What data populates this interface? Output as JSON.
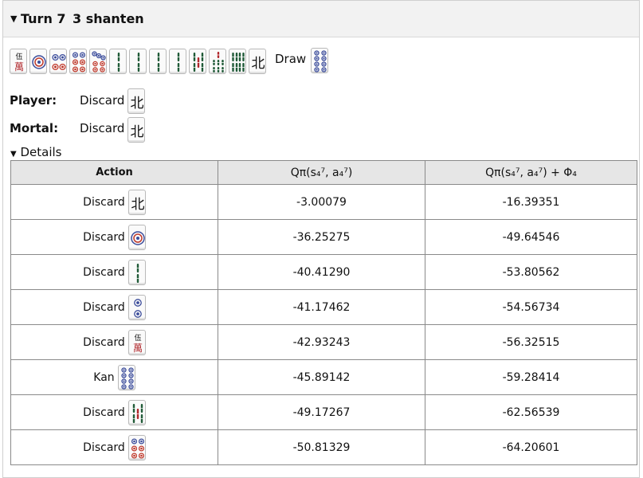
{
  "header": {
    "turn_label": "Turn 7",
    "shanten_label": "3 shanten"
  },
  "hand": {
    "tiles": [
      "7m",
      "1p",
      "4p",
      "6p",
      "7p",
      "1s",
      "1s",
      "1s",
      "2s",
      "5s",
      "7s",
      "8s",
      "N"
    ],
    "draw_label": "Draw",
    "draw_tile": "8p"
  },
  "player": {
    "label": "Player:",
    "action": "Discard",
    "tile": "N"
  },
  "mortal": {
    "label": "Mortal:",
    "action": "Discard",
    "tile": "N"
  },
  "details": {
    "label": "Details"
  },
  "table": {
    "headers": [
      "Action",
      "Qπ(s₄⁷, a₄⁷)",
      "Qπ(s₄⁷, a₄⁷) + Φ₄"
    ],
    "rows": [
      {
        "action": "Discard",
        "tile": "N",
        "q": "-3.00079",
        "qphi": "-16.39351"
      },
      {
        "action": "Discard",
        "tile": "1p",
        "q": "-36.25275",
        "qphi": "-49.64546"
      },
      {
        "action": "Discard",
        "tile": "2s",
        "q": "-40.41290",
        "qphi": "-53.80562"
      },
      {
        "action": "Discard",
        "tile": "2p",
        "q": "-41.17462",
        "qphi": "-54.56734"
      },
      {
        "action": "Discard",
        "tile": "7m",
        "q": "-42.93243",
        "qphi": "-56.32515"
      },
      {
        "action": "Kan",
        "tile": "8p",
        "q": "-45.89142",
        "qphi": "-59.28414"
      },
      {
        "action": "Discard",
        "tile": "5s",
        "q": "-49.17267",
        "qphi": "-62.56539"
      },
      {
        "action": "Discard",
        "tile": "6p",
        "q": "-50.81329",
        "qphi": "-64.20601"
      }
    ]
  },
  "colors": {
    "header_bg": "#f2f2f2",
    "th_bg": "#e6e6e6",
    "border": "#8a8a8a",
    "pin_blue": "#3b4c9b",
    "pin_red": "#c0392b",
    "sou_green": "#1f5a37",
    "man_red": "#b0262b"
  }
}
